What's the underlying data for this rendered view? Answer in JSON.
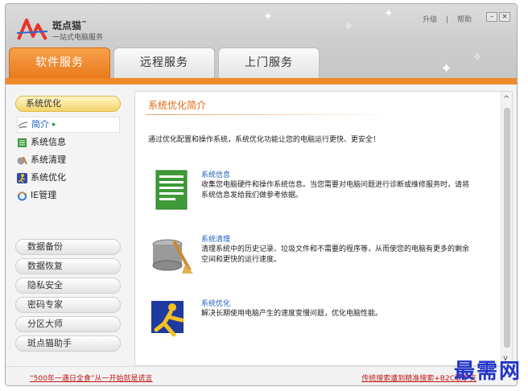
{
  "app": {
    "name": "斑点猫",
    "tm": "™",
    "slogan": "一站式电脑服务"
  },
  "topmenu": {
    "upgrade": "升级",
    "help": "帮助"
  },
  "window_controls": {
    "minimize": "–",
    "close": "×"
  },
  "tabs": [
    {
      "label": "软件服务",
      "active": true
    },
    {
      "label": "远程服务",
      "active": false
    },
    {
      "label": "上门服务",
      "active": false
    }
  ],
  "sidebar": {
    "header": "系统优化",
    "subitems": [
      {
        "label": "简介",
        "icon": "hand-pointer-icon",
        "active": true,
        "arrow": "▸"
      },
      {
        "label": "系统信息",
        "icon": "system-info-icon"
      },
      {
        "label": "系统清理",
        "icon": "broom-icon"
      },
      {
        "label": "系统优化",
        "icon": "runner-icon"
      },
      {
        "label": "IE管理",
        "icon": "ie-icon"
      }
    ],
    "buttons": [
      "数据备份",
      "数据恢复",
      "隐私安全",
      "密码专家",
      "分区大师",
      "斑点猫助手"
    ]
  },
  "main": {
    "title": "系统优化简介",
    "intro": "通过优化配置和操作系统，系统优化功能让您的电脑运行更快、更安全！",
    "features": [
      {
        "name": "系统信息",
        "desc": "收集您电脑硬件和操作系统信息。当您需要对电脑问题进行诊断或维修服务时，请将系统信息发给我们做参考依据。"
      },
      {
        "name": "系统清理",
        "desc": "清理系统中的历史记录、垃圾文件和不需要的程序等，从而使您的电脑有更多的剩余空间和更快的运行速度。"
      },
      {
        "name": "系统优化",
        "desc": "解决长期使用电脑产生的速度变慢问题，优化电脑性能。"
      }
    ]
  },
  "bottom": {
    "left_ad": "“500年一遇日全食”从一开始就是谎言",
    "right_ad": "传统搜索遭到精准搜索+B2C联手夹"
  },
  "watermark": "最需网",
  "colors": {
    "accent": "#ef8a2a",
    "link": "#1f5fb8",
    "ad": "#c01818"
  }
}
